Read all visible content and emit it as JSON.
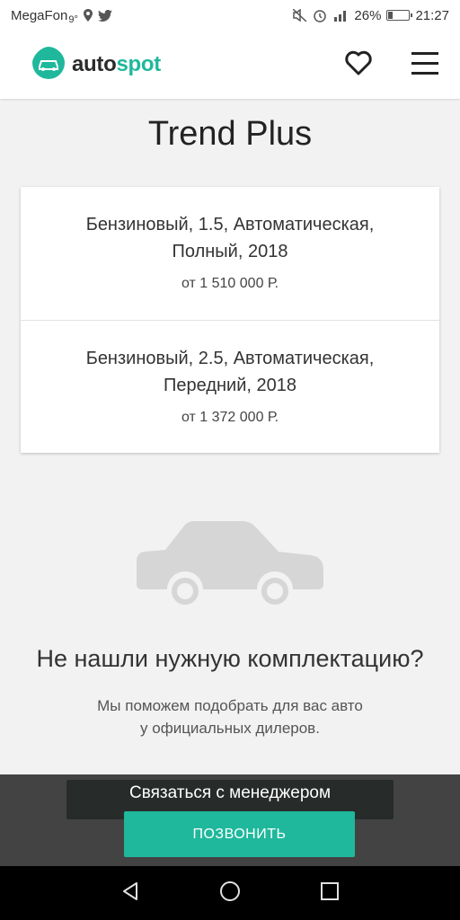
{
  "status_bar": {
    "carrier": "MegaFon",
    "temperature": "9°",
    "battery_percent": "26%",
    "battery_level": 0.26,
    "time": "21:27"
  },
  "header": {
    "logo_text_auto": "auto",
    "logo_text_spot": "spot"
  },
  "main": {
    "title": "Trend Plus",
    "options": [
      {
        "description": "Бензиновый, 1.5, Автоматическая, Полный, 2018",
        "price": "от 1 510 000 Р."
      },
      {
        "description": "Бензиновый, 2.5, Автоматическая, Передний, 2018",
        "price": "от 1 372 000 Р."
      }
    ],
    "not_found_title": "Не нашли нужную комплектацию?",
    "not_found_text_line1": "Мы поможем подобрать для вас авто",
    "not_found_text_line2": "у официальных дилеров."
  },
  "contact_bar": {
    "title": "Связаться с менеджером",
    "call_button": "ПОЗВОНИТЬ"
  },
  "colors": {
    "accent": "#1fb89c",
    "background": "#f2f2f2",
    "overlay": "#262626"
  }
}
